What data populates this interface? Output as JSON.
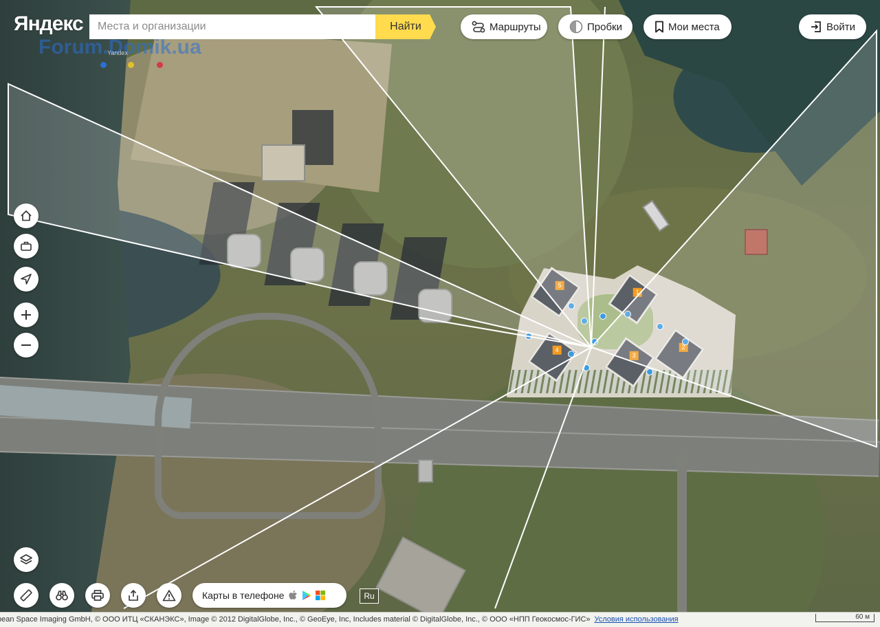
{
  "brand": {
    "logo_text": "Яндекс"
  },
  "watermark": {
    "text": "Forum.Domik.ua",
    "sub": "Yandex"
  },
  "search": {
    "placeholder": "Места и организации",
    "button_label": "Найти"
  },
  "header_buttons": {
    "routes": "Маршруты",
    "traffic": "Пробки",
    "my_places": "Мои места",
    "login": "Войти"
  },
  "map_controls": [
    "home-icon",
    "briefcase-icon",
    "locate-icon",
    "zoom-in-icon",
    "zoom-out-icon"
  ],
  "bottom_controls": [
    "layers-icon",
    "ruler-icon",
    "panorama-icon",
    "print-icon",
    "share-icon",
    "report-icon"
  ],
  "apps_pill": {
    "label": "Карты в телефоне"
  },
  "language": "Ru",
  "complex_towers": [
    "5",
    "1",
    "4",
    "3",
    "2"
  ],
  "footer": {
    "copyright": "pean Space Imaging GmbH, © ООО ИТЦ «СКАНЭКС», Image © 2012 DigitalGlobe, Inc., © GeoEye, Inc, Includes material © DigitalGlobe, Inc., © ООО «НПП Геокосмос-ГИС»",
    "terms": "Условия использования",
    "scale": "60 м"
  },
  "colors": {
    "accent_yellow": "#ffdb4d",
    "tower_badge": "#f39a1e",
    "pin_blue": "#3d9be0"
  }
}
